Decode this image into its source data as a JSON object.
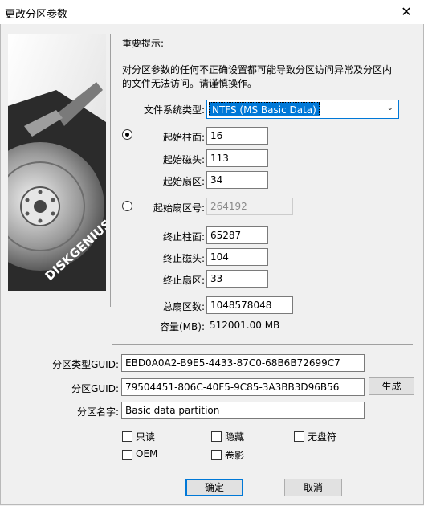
{
  "window": {
    "title": "更改分区参数",
    "close_glyph": "✕"
  },
  "notice": {
    "heading": "重要提示:",
    "line1": "对分区参数的任何不正确设置都可能导致分区访问异常及分区内",
    "line2": "的文件无法访问。请谨慎操作。"
  },
  "brand": "DISKGENIUS",
  "fs_type": {
    "label": "文件系统类型:",
    "value": "NTFS (MS Basic Data)"
  },
  "start_chs": {
    "cylinder_label": "起始柱面:",
    "cylinder": "16",
    "head_label": "起始磁头:",
    "head": "113",
    "sector_label": "起始扇区:",
    "sector": "34"
  },
  "start_lba": {
    "label": "起始扇区号:",
    "value": "264192"
  },
  "end_chs": {
    "cylinder_label": "终止柱面:",
    "cylinder": "65287",
    "head_label": "终止磁头:",
    "head": "104",
    "sector_label": "终止扇区:",
    "sector": "33"
  },
  "total": {
    "label": "总扇区数:",
    "value": "1048578048"
  },
  "capacity": {
    "label": "容量(MB):",
    "value": "512001.00 MB"
  },
  "guid": {
    "type_label": "分区类型GUID:",
    "type_value": "EBD0A0A2-B9E5-4433-87C0-68B6B72699C7",
    "part_label": "分区GUID:",
    "part_value": "79504451-806C-40F5-9C85-3A3BB3D96B56",
    "generate": "生成",
    "name_label": "分区名字:",
    "name_value": "Basic data partition"
  },
  "flags": {
    "readonly": "只读",
    "hidden": "隐藏",
    "no_drive_letter": "无盘符",
    "oem": "OEM",
    "shadow": "卷影"
  },
  "buttons": {
    "ok": "确定",
    "cancel": "取消"
  },
  "colors": {
    "accent": "#0078d7"
  }
}
